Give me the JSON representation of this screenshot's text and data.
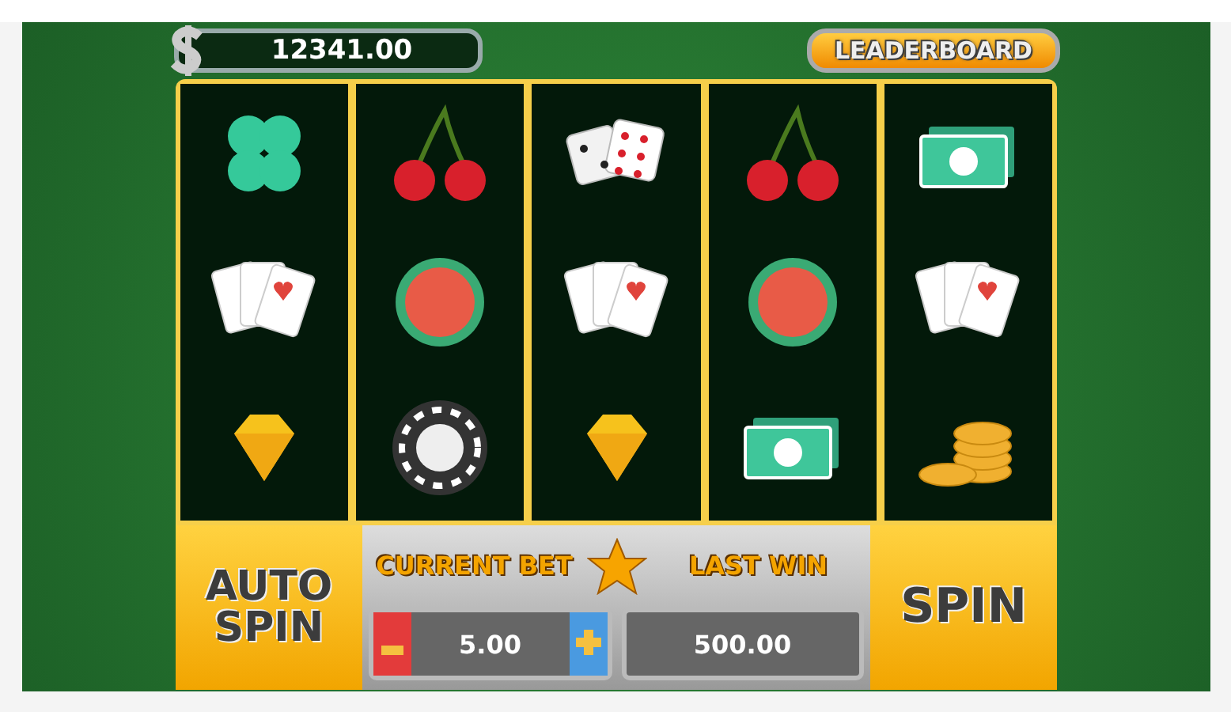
{
  "balance": {
    "value": "12341.00"
  },
  "leaderboard_button": {
    "label": "LEADERBOARD"
  },
  "reels": [
    {
      "symbols": [
        {
          "kind": "clover"
        },
        {
          "kind": "cards"
        },
        {
          "kind": "diamond"
        }
      ]
    },
    {
      "symbols": [
        {
          "kind": "cherry"
        },
        {
          "kind": "watermelon"
        },
        {
          "kind": "chip"
        }
      ]
    },
    {
      "symbols": [
        {
          "kind": "dice"
        },
        {
          "kind": "cards"
        },
        {
          "kind": "diamond"
        }
      ]
    },
    {
      "symbols": [
        {
          "kind": "cherry"
        },
        {
          "kind": "watermelon"
        },
        {
          "kind": "money"
        }
      ]
    },
    {
      "symbols": [
        {
          "kind": "money"
        },
        {
          "kind": "cards"
        },
        {
          "kind": "coins"
        }
      ]
    }
  ],
  "auto_spin_button": {
    "label": "AUTO SPIN"
  },
  "current_bet": {
    "label": "CURRENT BET",
    "value": "5.00"
  },
  "last_win": {
    "label": "LAST WIN",
    "value": "500.00"
  },
  "spin_button": {
    "label": "SPIN"
  }
}
